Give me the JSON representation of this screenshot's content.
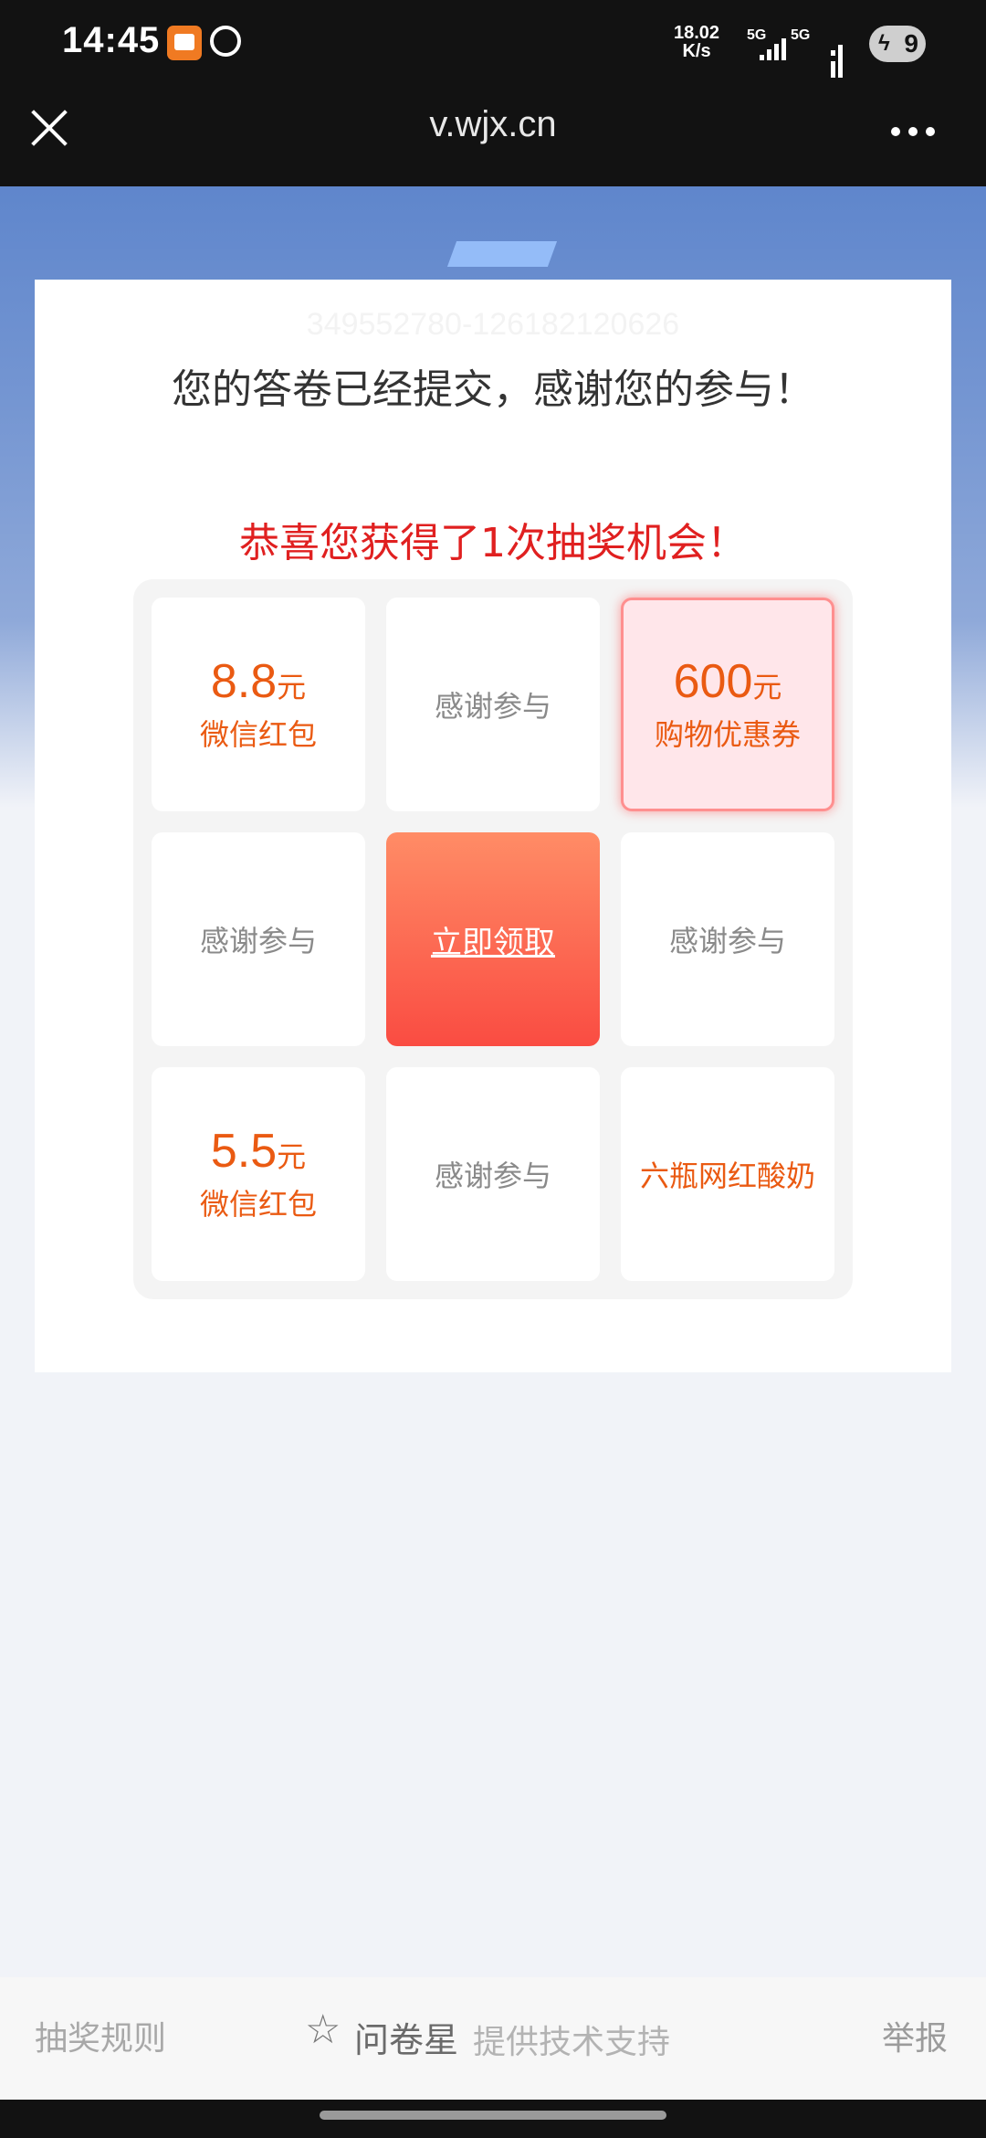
{
  "status_bar": {
    "time": "14:45",
    "net_speed": "18.02",
    "net_unit": "K/s",
    "sim1": "5G",
    "sim2": "5G",
    "battery": "9"
  },
  "title_bar": {
    "url": "v.wjx.cn"
  },
  "card": {
    "watermark": "349552780-126182120626",
    "thanks": "您的答卷已经提交，感谢您的参与！",
    "congrats": "恭喜您获得了1次抽奖机会！"
  },
  "lottery": {
    "prize_1_amount": "8.8",
    "prize_1_unit": "元",
    "prize_1_desc": "微信红包",
    "cell_2": "感谢参与",
    "prize_3_amount": "600",
    "prize_3_unit": "元",
    "prize_3_desc": "购物优惠券",
    "cell_4": "感谢参与",
    "claim_button": "立即领取",
    "cell_6": "感谢参与",
    "prize_7_amount": "5.5",
    "prize_7_unit": "元",
    "prize_7_desc": "微信红包",
    "cell_8": "感谢参与",
    "prize_9_desc": "六瓶网红酸奶"
  },
  "footer": {
    "rules": "抽奖规则",
    "brand": "问卷星",
    "tech_support": "提供技术支持",
    "report": "举报"
  },
  "colors": {
    "prize_orange": "#ea5a12",
    "congrats_red": "#e02020",
    "claim_button_top": "#ff8c66",
    "claim_button_bottom": "#fa4c42"
  }
}
